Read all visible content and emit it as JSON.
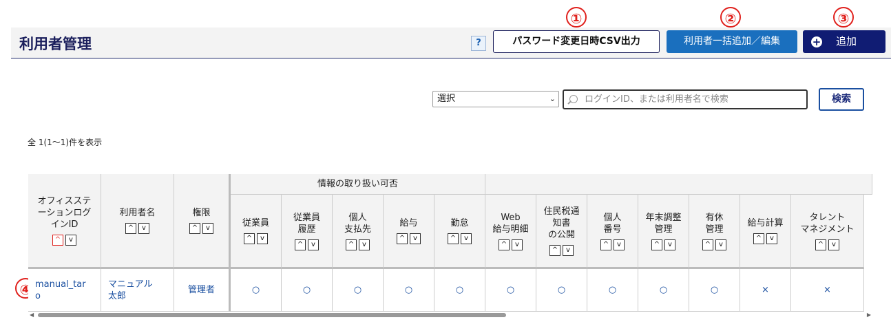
{
  "markers": [
    "①",
    "②",
    "③",
    "④"
  ],
  "header": {
    "title": "利用者管理",
    "help": "?",
    "csv_button": "パスワード変更日時CSV出力",
    "bulk_button": "利用者一括追加／編集",
    "add_button": "追加"
  },
  "search": {
    "select_value": "選択",
    "placeholder": "ログインID、または利用者名で検索",
    "button": "検索"
  },
  "count_text": "全 1(1～1)件を表示",
  "table": {
    "group_header": "情報の取り扱い可否",
    "columns": {
      "login_id": "オフィスステ\nーションログ\nインID",
      "user_name": "利用者名",
      "role": "権限",
      "c1": "従業員",
      "c2": "従業員\n履歴",
      "c3": "個人\n支払先",
      "c4": "給与",
      "c5": "勤怠",
      "c6": "Web\n給与明細",
      "c7": "住民税通\n知書\nの公開",
      "c8": "個人\n番号",
      "c9": "年末調整\n管理",
      "c10": "有休\n管理",
      "c11": "給与計算",
      "c12": "タレント\nマネジメント"
    },
    "sort_up": "^",
    "sort_down": "v",
    "row": {
      "login_id": "manual_tar\no",
      "user_name": "マニュアル\n太郎",
      "role": "管理者",
      "c1": "○",
      "c2": "○",
      "c3": "○",
      "c4": "○",
      "c5": "○",
      "c6": "○",
      "c7": "○",
      "c8": "○",
      "c9": "○",
      "c10": "○",
      "c11": "×",
      "c12": "×"
    }
  },
  "colors": {
    "navy": "#101c73",
    "blue": "#1a6fbe",
    "marker_red": "#e0201c"
  }
}
